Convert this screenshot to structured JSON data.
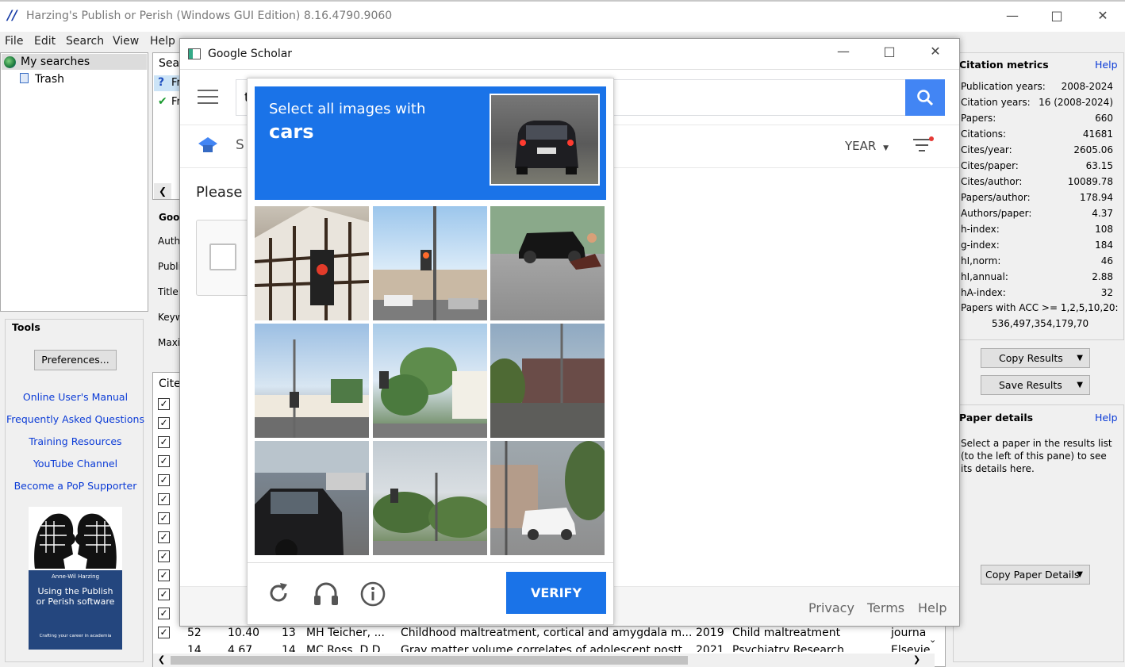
{
  "app": {
    "logo": "//",
    "title": "Harzing's Publish or Perish (Windows GUI Edition) 8.16.4790.9060",
    "menus": [
      "File",
      "Edit",
      "Search",
      "View",
      "Help"
    ]
  },
  "tree": {
    "my_searches": "My searches",
    "trash": "Trash"
  },
  "search_list": {
    "header": "Sear",
    "rows": [
      "Fr",
      "Fr"
    ],
    "query_label": "Goo",
    "fields": [
      "Auth",
      "Publi",
      "Title",
      "Keyw",
      "Maxi"
    ]
  },
  "tools": {
    "title": "Tools",
    "preferences": "Preferences...",
    "links": [
      "Online User's Manual",
      "Frequently Asked Questions",
      "Training Resources",
      "YouTube Channel",
      "Become a PoP Supporter"
    ],
    "book": {
      "author": "Anne-Wil Harzing",
      "title": "Using the Publish or Perish software",
      "subtitle": "Crafting your career in academia"
    }
  },
  "results": {
    "header": "Cite",
    "row": {
      "cites": "52",
      "per_year": "10.40",
      "rank": "13",
      "authors": "MH Teicher, ...",
      "title": "Childhood maltreatment, cortical and amygdala m...",
      "year": "2019",
      "source": "Child maltreatment",
      "type": "journa"
    },
    "partial_row": {
      "cites": "14",
      "per_year": "4.67",
      "rank": "14",
      "authors": "MC Ross, D.D...",
      "title": "Gray matter volume correlates of adolescent postt...",
      "year": "2021",
      "source": "Psychiatry Research",
      "type": "Elsevie"
    }
  },
  "metrics": {
    "title": "Citation metrics",
    "help": "Help",
    "rows": [
      {
        "label": "Publication years:",
        "value": "2008-2024"
      },
      {
        "label": "Citation years:",
        "value": "16 (2008-2024)"
      },
      {
        "label": "Papers:",
        "value": "660"
      },
      {
        "label": "Citations:",
        "value": "41681"
      },
      {
        "label": "Cites/year:",
        "value": "2605.06"
      },
      {
        "label": "Cites/paper:",
        "value": "63.15"
      },
      {
        "label": "Cites/author:",
        "value": "10089.78"
      },
      {
        "label": "Papers/author:",
        "value": "178.94"
      },
      {
        "label": "Authors/paper:",
        "value": "4.37"
      },
      {
        "label": "h-index:",
        "value": "108"
      },
      {
        "label": "g-index:",
        "value": "184"
      },
      {
        "label": "hI,norm:",
        "value": "46"
      },
      {
        "label": "hI,annual:",
        "value": "2.88"
      },
      {
        "label": "hA-index:",
        "value": "32"
      }
    ],
    "acc_label": "Papers with ACC >= 1,2,5,10,20:",
    "acc_value": "536,497,354,179,70",
    "copy_results": "Copy Results",
    "save_results": "Save Results"
  },
  "paper_details": {
    "title": "Paper details",
    "help": "Help",
    "text": "Select a paper in the results list (to the left of this pane) to see its details here.",
    "copy_button": "Copy Paper Details"
  },
  "scholar": {
    "window_title": "Google Scholar",
    "search_prefix": "t",
    "tab_letter": "S",
    "year_label": "YEAR",
    "please": "Please",
    "footer": [
      "Privacy",
      "Terms",
      "Help"
    ]
  },
  "captcha": {
    "instruction": "Select all images with",
    "target": "cars",
    "verify": "VERIFY"
  },
  "colors": {
    "accent": "#1a73e8",
    "link": "#0b3bd6",
    "title_gray": "#7a7a7a"
  }
}
